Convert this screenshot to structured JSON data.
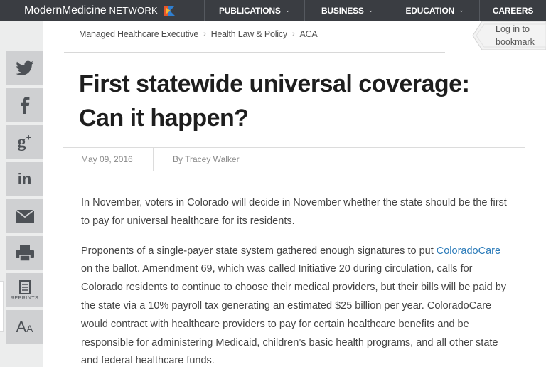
{
  "header": {
    "brand_name": "ModernMedicine",
    "brand_sub": "NETWORK",
    "nav": [
      {
        "label": "PUBLICATIONS"
      },
      {
        "label": "BUSINESS"
      },
      {
        "label": "EDUCATION"
      },
      {
        "label": "CAREERS"
      }
    ]
  },
  "share": {
    "reprints_label": "REPRINTS"
  },
  "login": {
    "line1": "Log in to",
    "line2": "bookmark"
  },
  "breadcrumb": [
    "Managed Healthcare Executive",
    "Health Law & Policy",
    "ACA"
  ],
  "article": {
    "title": "First statewide universal coverage: Can it happen?",
    "date": "May 09, 2016",
    "author": "By Tracey Walker",
    "p1": "In November, voters in Colorado will decide in November whether the state should be the first to pay for universal healthcare for its residents.",
    "p2_before": "Proponents of a single-payer state system gathered enough signatures to put ",
    "p2_link": "ColoradoCare",
    "p2_after": " on the ballot. Amendment 69, which was called Initiative 20 during circulation, calls for Colorado residents to continue to choose their medical providers, but their bills will be paid by the state via a 10% payroll tax generating an estimated $25 billion per year. ColoradoCare would contract with healthcare providers to pay for certain healthcare benefits and be responsible for administering Medicaid, children’s basic health programs, and all other state and federal healthcare funds."
  },
  "colors": {
    "topbar": "#3a3d42",
    "link": "#2b7bb9",
    "share_button": "#cfd0d2"
  }
}
